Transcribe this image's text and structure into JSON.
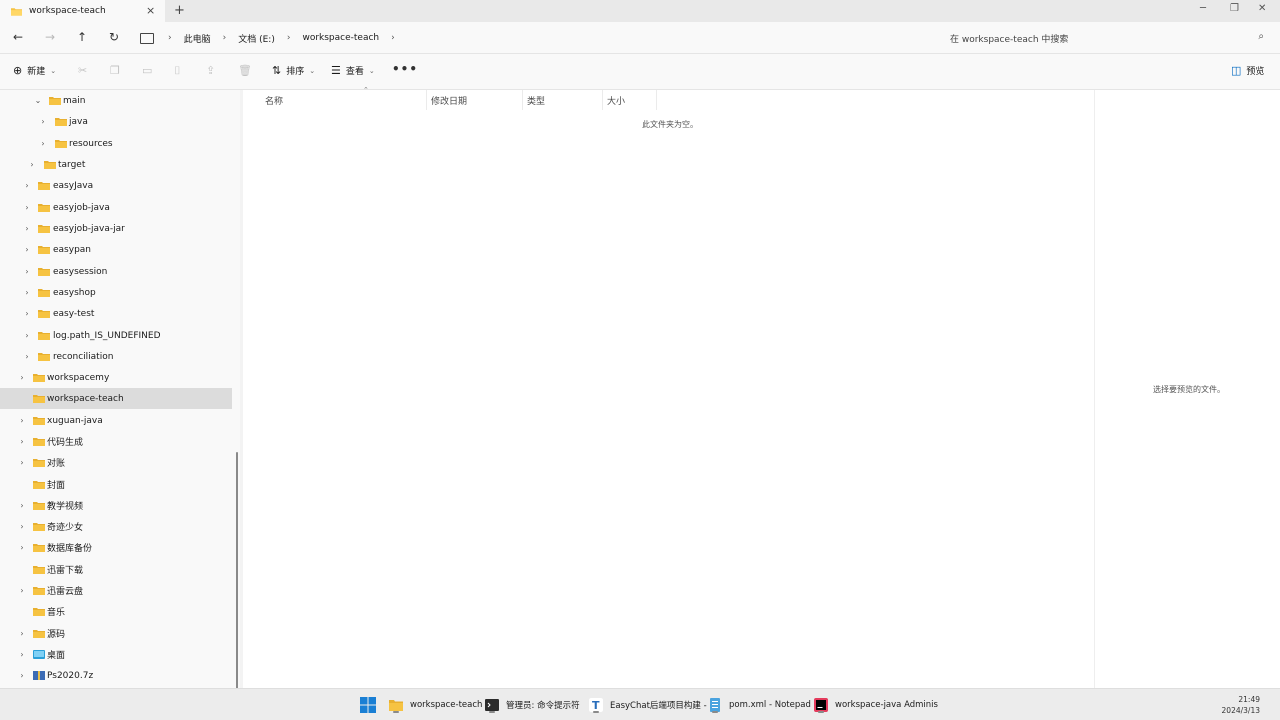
{
  "window": {
    "tab_title": "workspace-teach",
    "tab_close_icon": "×",
    "new_tab_icon": "+"
  },
  "nav": {
    "breadcrumbs": [
      "此电脑",
      "文档 (E:)",
      "workspace-teach"
    ],
    "search_placeholder": "在 workspace-teach 中搜索"
  },
  "toolbar": {
    "new_label": "新建",
    "sort_label": "排序",
    "view_label": "查看",
    "more_label": "•••",
    "preview_label": "预览"
  },
  "sidebar": {
    "items": [
      {
        "label": "main",
        "expanded": true
      },
      {
        "label": "java"
      },
      {
        "label": "resources"
      },
      {
        "label": "target"
      },
      {
        "label": "easyJava"
      },
      {
        "label": "easyjob-java"
      },
      {
        "label": "easyjob-java-jar"
      },
      {
        "label": "easypan"
      },
      {
        "label": "easysession"
      },
      {
        "label": "easyshop"
      },
      {
        "label": "easy-test"
      },
      {
        "label": "log.path_IS_UNDEFINED"
      },
      {
        "label": "reconciliation"
      },
      {
        "label": "workspacemy"
      },
      {
        "label": "workspace-teach",
        "selected": true
      },
      {
        "label": "xuguan-java"
      },
      {
        "label": "代码生成"
      },
      {
        "label": "对账"
      },
      {
        "label": "封面"
      },
      {
        "label": "教学视频"
      },
      {
        "label": "奇迹少女"
      },
      {
        "label": "数据库备份"
      },
      {
        "label": "迅雷下载"
      },
      {
        "label": "迅雷云盘"
      },
      {
        "label": "音乐"
      },
      {
        "label": "源码"
      },
      {
        "label": "桌面"
      },
      {
        "label": "Ps2020.7z"
      }
    ]
  },
  "content": {
    "columns": [
      "名称",
      "修改日期",
      "类型",
      "大小"
    ],
    "empty_message": "此文件夹为空。",
    "preview_message": "选择要预览的文件。"
  },
  "taskbar": {
    "items": [
      {
        "label": "workspace-teach"
      },
      {
        "label": "管理员: 命令提示符"
      },
      {
        "label": "EasyChat后端项目构建 -"
      },
      {
        "label": "pom.xml - Notepad"
      },
      {
        "label": "workspace-java Adminis"
      }
    ],
    "time": "21:49",
    "date": "2024/3/13"
  },
  "colors": {
    "folder": "#f6c342",
    "selected_bg": "#dcdcdc",
    "accent": "#0067c0"
  }
}
